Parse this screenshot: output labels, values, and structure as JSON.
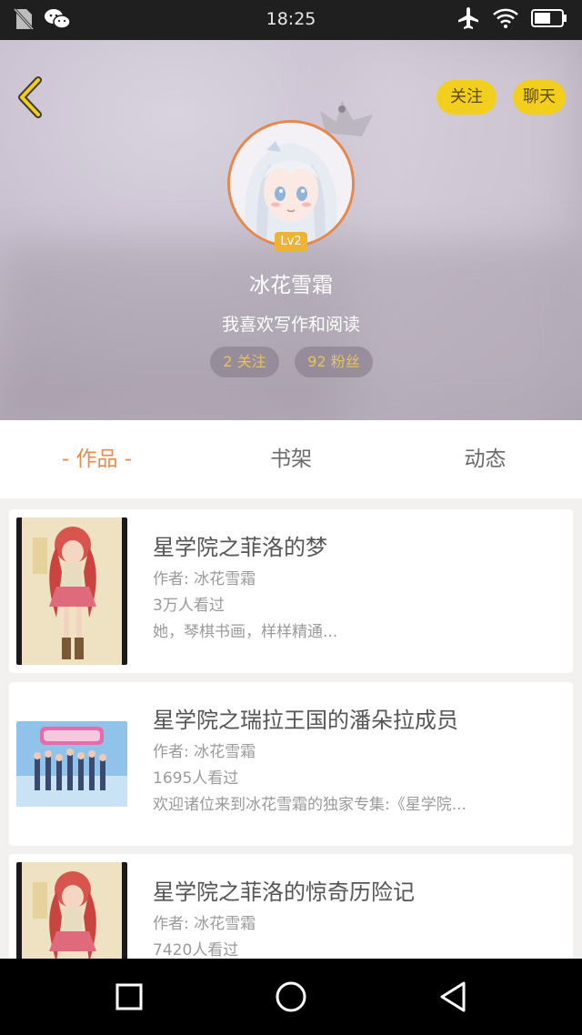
{
  "status_bar": {
    "time": "18:25",
    "icons_left": [
      "no-sim-icon",
      "wechat-icon"
    ],
    "icons_right": [
      "airplane-icon",
      "wifi-icon",
      "battery-icon"
    ]
  },
  "profile": {
    "back_icon": "chevron-left-icon",
    "follow_label": "关注",
    "chat_label": "聊天",
    "level": "Lv2",
    "nickname": "冰花雪霜",
    "signature": "我喜欢写作和阅读",
    "following_text": "2 关注",
    "fans_text": "92 粉丝",
    "accent_color": "#f3cf1d"
  },
  "tabs": [
    {
      "label": "- 作品 -",
      "active": true
    },
    {
      "label": "书架",
      "active": false
    },
    {
      "label": "动态",
      "active": false
    }
  ],
  "works": [
    {
      "title": "星学院之菲洛的梦",
      "author": "作者: 冰花雪霜",
      "views": "3万人看过",
      "desc": "她，琴棋书画，样样精通..."
    },
    {
      "title": "星学院之瑞拉王国的潘朵拉成员",
      "author": "作者: 冰花雪霜",
      "views": "1695人看过",
      "desc": "欢迎诸位来到冰花雪霜的独家专集:《星学院..."
    },
    {
      "title": "星学院之菲洛的惊奇历险记",
      "author": "作者: 冰花雪霜",
      "views": "7420人看过",
      "desc": ""
    }
  ],
  "nav_bar": {
    "icons": [
      "square-recent-icon",
      "circle-home-icon",
      "triangle-back-icon"
    ]
  }
}
